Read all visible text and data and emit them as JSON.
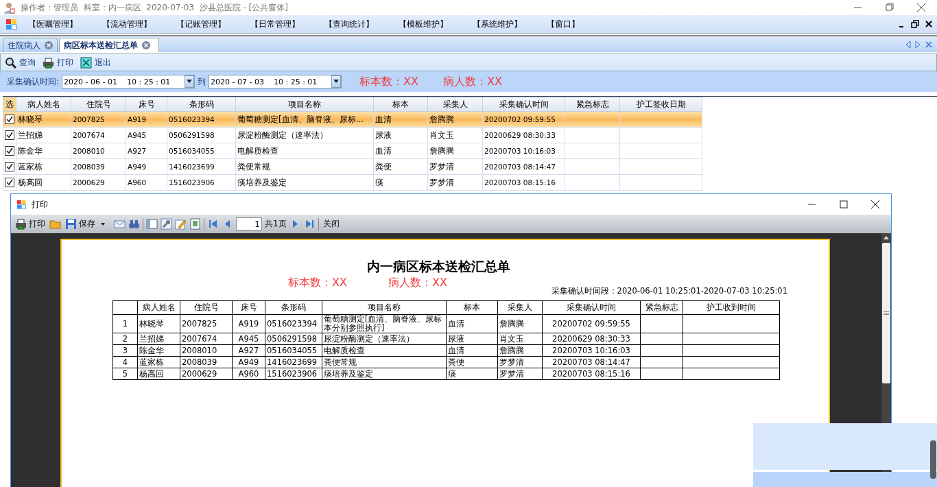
{
  "window": {
    "title": "操作者：管理员  科室：内一病区  2020-07-03  沙县总医院 - [公共窗体]"
  },
  "menu": [
    "【医嘱管理】",
    "【流动管理】",
    "【记账管理】",
    "【日常管理】",
    "【查询统计】",
    "【模板维护】",
    "【系统维护】",
    "【窗口】"
  ],
  "tabs": [
    {
      "label": "住院病人",
      "selected": false
    },
    {
      "label": "病区标本送检汇总单",
      "selected": true
    }
  ],
  "toolbar": [
    {
      "kind": "search",
      "label": "查询"
    },
    {
      "kind": "printer",
      "label": "打印"
    },
    {
      "kind": "exit",
      "label": "退出"
    }
  ],
  "filter": {
    "label": "采集确认时间:",
    "from": "2020 - 06 - 01    10 : 25 : 01",
    "separator": "到",
    "to": "2020 - 07 - 03    10 : 25 : 01",
    "specimen_count": "标本数：XX",
    "patient_count": "病人数：XX"
  },
  "grid": {
    "select_column": "选",
    "columns": [
      "病人姓名",
      "住院号",
      "床号",
      "条形码",
      "项目名称",
      "标本",
      "采集人",
      "采集确认时间",
      "紧急标志",
      "护工签收日期"
    ],
    "rows": [
      {
        "checked": true,
        "selected": true,
        "cells": [
          "林晓琴",
          "2007825",
          "A919",
          "0516023394",
          "葡萄糖测定[血清、脑脊液、尿标...",
          "血清",
          "詹腾腾",
          "20200702 09:59:55"
        ]
      },
      {
        "checked": true,
        "selected": false,
        "cells": [
          "兰招娣",
          "2007674",
          "A945",
          "0506291598",
          "尿淀粉酶测定（速率法）",
          "尿液",
          "肖文玉",
          "20200629 08:30:33"
        ]
      },
      {
        "checked": true,
        "selected": false,
        "cells": [
          "陈金华",
          "2008010",
          "A927",
          "0516034055",
          "电解质检查",
          "血清",
          "詹腾腾",
          "20200703 10:16:03"
        ]
      },
      {
        "checked": true,
        "selected": false,
        "cells": [
          "蓝家栋",
          "2008039",
          "A949",
          "1416023699",
          "粪便常规",
          "粪便",
          "罗梦清",
          "20200703 08:14:47"
        ]
      },
      {
        "checked": true,
        "selected": false,
        "cells": [
          "杨高回",
          "2000629",
          "A960",
          "1516023906",
          "痰培养及鉴定",
          "痰",
          "罗梦清",
          "20200703 08:15:16"
        ]
      }
    ]
  },
  "print_window": {
    "title": "打印",
    "toolbar": [
      {
        "kind": "printer",
        "label": "打印"
      },
      {
        "kind": "folder"
      },
      {
        "kind": "save",
        "label": "保存"
      },
      {
        "kind": "caret"
      },
      {
        "kind": "mail"
      },
      {
        "kind": "binoculars"
      },
      {
        "kind": "separator"
      },
      {
        "kind": "layout"
      },
      {
        "kind": "wrench"
      },
      {
        "kind": "pencil"
      },
      {
        "kind": "page"
      },
      {
        "kind": "separator"
      },
      {
        "kind": "first"
      },
      {
        "kind": "prev"
      },
      {
        "kind": "pagefield",
        "value": "1"
      },
      {
        "kind": "text",
        "label": "共1页"
      },
      {
        "kind": "next"
      },
      {
        "kind": "last"
      },
      {
        "kind": "separator"
      },
      {
        "kind": "close",
        "label": "关闭"
      }
    ],
    "report": {
      "title": "内一病区标本送检汇总单",
      "specimen_count": "标本数：XX",
      "patient_count": "病人数：XX",
      "time_range": "采集确认时间段：2020-06-01 10:25:01-2020-07-03 10:25:01",
      "columns": [
        "病人姓名",
        "住院号",
        "床号",
        "条形码",
        "项目名称",
        "标本",
        "采集人",
        "采集确认时间",
        "紧急标志",
        "护工收到时间"
      ],
      "rows": [
        {
          "number": "1",
          "cells": [
            "林晓琴",
            "2007825",
            "A919",
            "0516023394",
            "葡萄糖测定[血清、脑脊液、尿标本分别参照执行]",
            "血清",
            "詹腾腾",
            "20200702 09:59:55"
          ]
        },
        {
          "number": "2",
          "cells": [
            "兰招娣",
            "2007674",
            "A945",
            "0506291598",
            "尿淀粉酶测定（速率法）",
            "尿液",
            "肖文玉",
            "20200629 08:30:33"
          ]
        },
        {
          "number": "3",
          "cells": [
            "陈金华",
            "2008010",
            "A927",
            "0516034055",
            "电解质检查",
            "血清",
            "詹腾腾",
            "20200703 10:16:03"
          ]
        },
        {
          "number": "4",
          "cells": [
            "蓝家栋",
            "2008039",
            "A949",
            "1416023699",
            "粪便常规",
            "粪便",
            "罗梦清",
            "20200703 08:14:47"
          ]
        },
        {
          "number": "5",
          "cells": [
            "杨高回",
            "2000629",
            "A960",
            "1516023906",
            "痰培养及鉴定",
            "痰",
            "罗梦清",
            "20200703 08:15:16"
          ]
        }
      ]
    }
  }
}
